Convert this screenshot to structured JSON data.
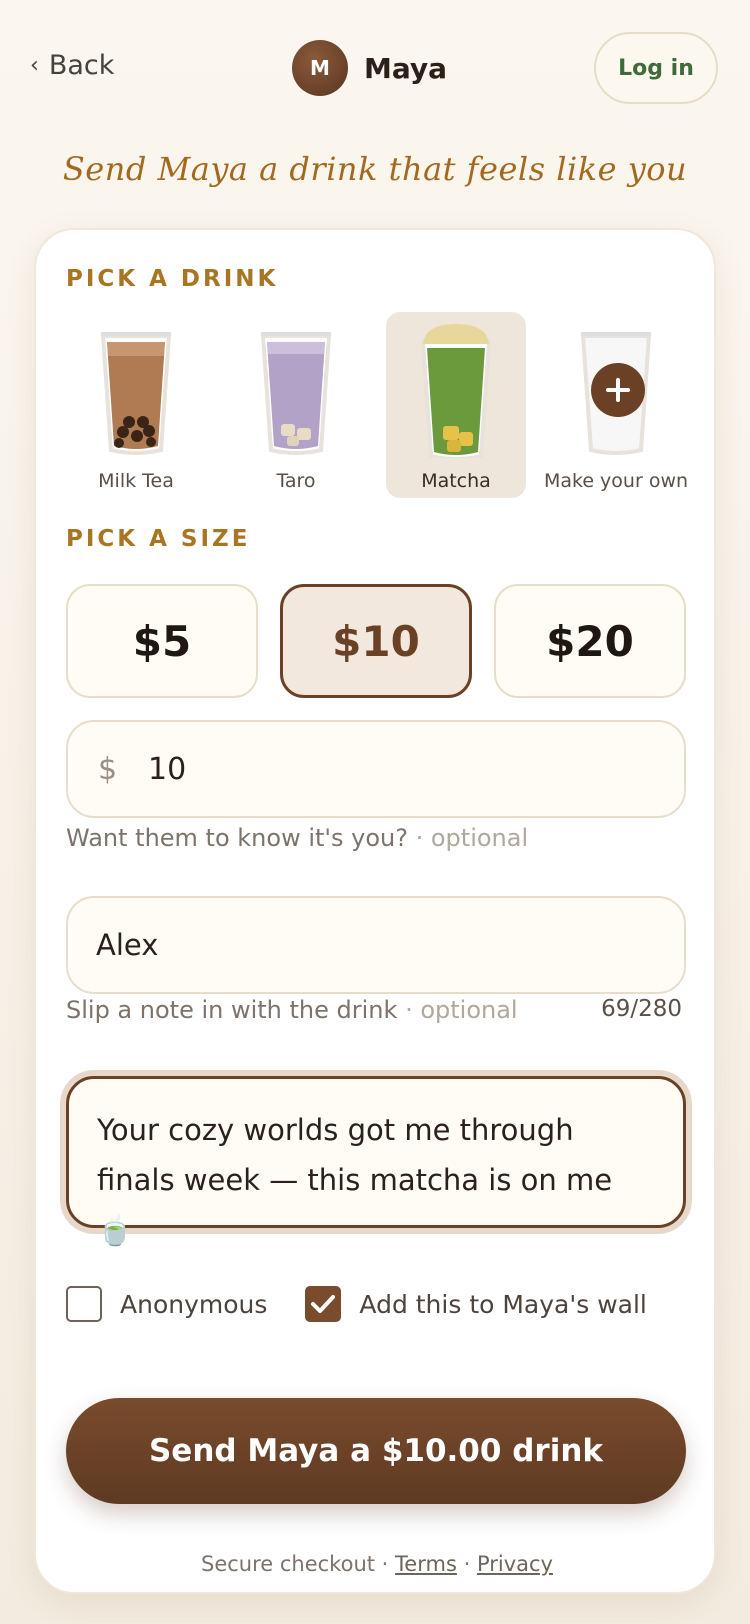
{
  "header": {
    "back_label": "Back",
    "creator_initial": "M",
    "creator_name": "Maya",
    "login_label": "Log in"
  },
  "tagline": "Send Maya a drink that feels like you",
  "drink_section": {
    "label": "PICK A DRINK",
    "items": [
      {
        "label": "Milk Tea",
        "selected": false,
        "icon": "milk-tea-cup-icon"
      },
      {
        "label": "Taro",
        "selected": false,
        "icon": "taro-cup-icon"
      },
      {
        "label": "Matcha",
        "selected": true,
        "icon": "matcha-cup-icon"
      },
      {
        "label": "Make your own",
        "selected": false,
        "icon": "plus-icon"
      }
    ]
  },
  "size_section": {
    "label": "PICK A SIZE",
    "options": [
      "$5",
      "$10",
      "$20"
    ],
    "selected": "$10",
    "custom_currency": "$",
    "custom_value": "10"
  },
  "name_field": {
    "label": "Want them to know it's you?",
    "optional": "· optional",
    "value": "Alex"
  },
  "note_field": {
    "label": "Slip a note in with the drink",
    "optional": "· optional",
    "counter": "69/280",
    "value": "Your cozy worlds got me through finals week — this matcha is on me 🍵"
  },
  "options": {
    "anonymous_label": "Anonymous",
    "anonymous_checked": false,
    "wall_label": "Add this to Maya's wall",
    "wall_checked": true
  },
  "cta_label": "Send Maya a $10.00 drink",
  "footer": {
    "secure": "Secure checkout",
    "sep": "·",
    "terms": "Terms",
    "privacy": "Privacy"
  },
  "colors": {
    "accent_brown": "#6a4125",
    "label_gold": "#a87623",
    "login_green": "#3f6b3a",
    "background": "#f6efe3"
  }
}
